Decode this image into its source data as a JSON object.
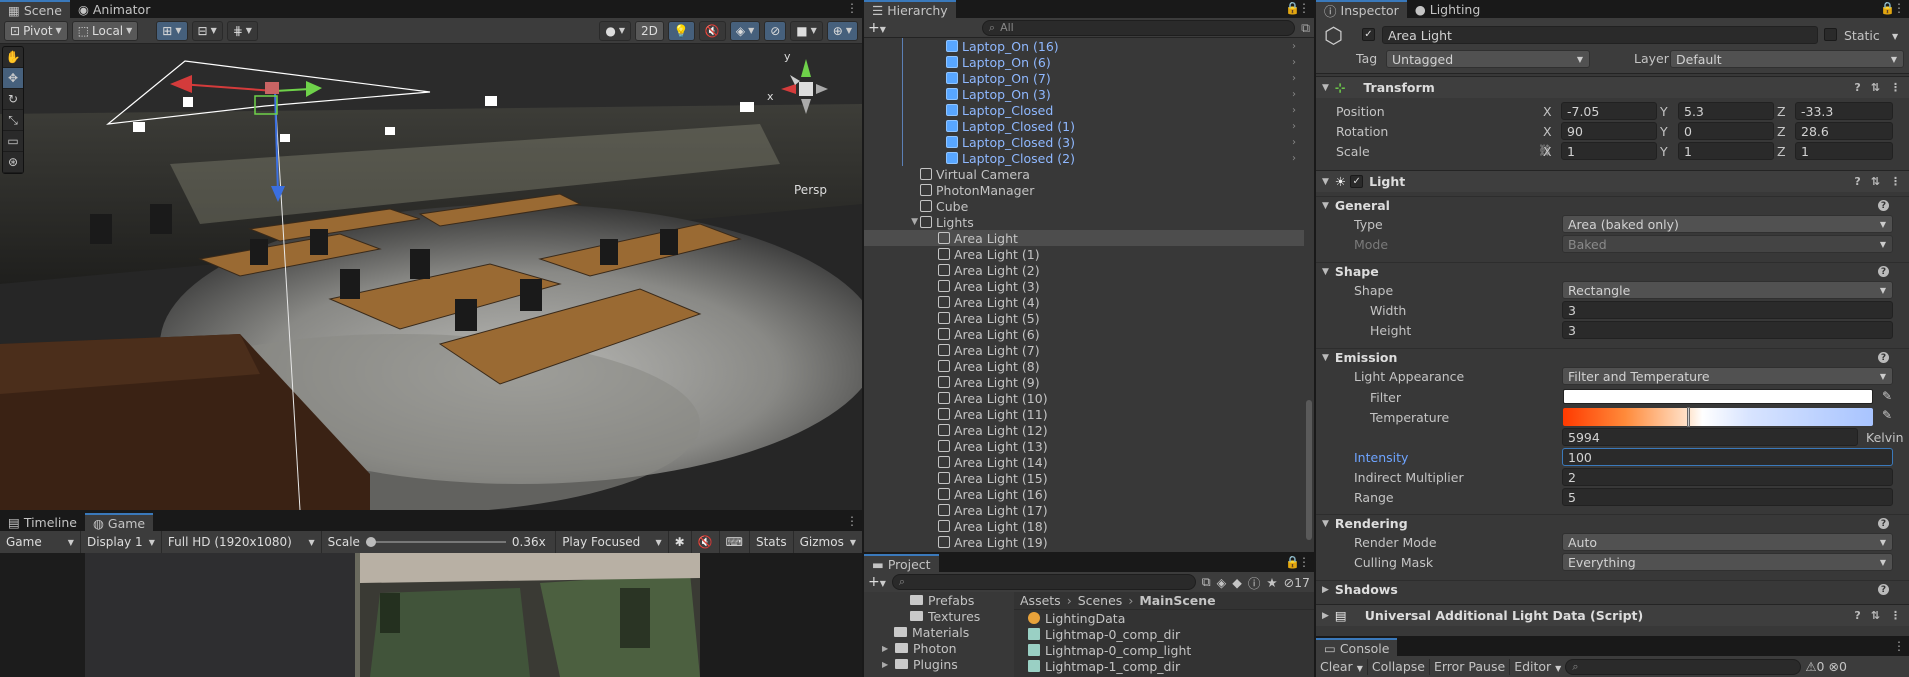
{
  "scene": {
    "tabs": [
      {
        "label": "Scene",
        "active": true
      },
      {
        "label": "Animator",
        "active": false
      }
    ],
    "toolbar": {
      "pivot": "Pivot",
      "local": "Local",
      "mode_2d": "2D"
    },
    "persp_label": "Persp",
    "gizmo_axes": {
      "x": "x",
      "y": "y"
    }
  },
  "game": {
    "tabs": [
      {
        "label": "Timeline",
        "active": false
      },
      {
        "label": "Game",
        "active": true
      }
    ],
    "toolbar": {
      "view": "Game",
      "display": "Display 1",
      "resolution": "Full HD (1920x1080)",
      "scale_label": "Scale",
      "scale_value": "0.36x",
      "play_mode": "Play Focused",
      "stats": "Stats",
      "gizmos": "Gizmos"
    }
  },
  "hierarchy": {
    "tab": "Hierarchy",
    "search_placeholder": "All",
    "items": [
      {
        "label": "Laptop_On (16)",
        "depth": 2,
        "prefab": true,
        "arrow": true
      },
      {
        "label": "Laptop_On (6)",
        "depth": 2,
        "prefab": true,
        "arrow": true
      },
      {
        "label": "Laptop_On (7)",
        "depth": 2,
        "prefab": true,
        "arrow": true
      },
      {
        "label": "Laptop_On (3)",
        "depth": 2,
        "prefab": true,
        "arrow": true
      },
      {
        "label": "Laptop_Closed",
        "depth": 2,
        "prefab": true,
        "arrow": true
      },
      {
        "label": "Laptop_Closed (1)",
        "depth": 2,
        "prefab": true,
        "arrow": true
      },
      {
        "label": "Laptop_Closed (3)",
        "depth": 2,
        "prefab": true,
        "arrow": true
      },
      {
        "label": "Laptop_Closed (2)",
        "depth": 2,
        "prefab": true,
        "arrow": true
      },
      {
        "label": "Virtual Camera",
        "depth": 1,
        "prefab": false
      },
      {
        "label": "PhotonManager",
        "depth": 1,
        "prefab": false
      },
      {
        "label": "Cube",
        "depth": 1,
        "prefab": false
      },
      {
        "label": "Lights",
        "depth": 1,
        "prefab": false,
        "expanded": true
      },
      {
        "label": "Area Light",
        "depth": 2,
        "prefab": false,
        "selected": true
      },
      {
        "label": "Area Light (1)",
        "depth": 2,
        "prefab": false
      },
      {
        "label": "Area Light (2)",
        "depth": 2,
        "prefab": false
      },
      {
        "label": "Area Light (3)",
        "depth": 2,
        "prefab": false
      },
      {
        "label": "Area Light (4)",
        "depth": 2,
        "prefab": false
      },
      {
        "label": "Area Light (5)",
        "depth": 2,
        "prefab": false
      },
      {
        "label": "Area Light (6)",
        "depth": 2,
        "prefab": false
      },
      {
        "label": "Area Light (7)",
        "depth": 2,
        "prefab": false
      },
      {
        "label": "Area Light (8)",
        "depth": 2,
        "prefab": false
      },
      {
        "label": "Area Light (9)",
        "depth": 2,
        "prefab": false
      },
      {
        "label": "Area Light (10)",
        "depth": 2,
        "prefab": false
      },
      {
        "label": "Area Light (11)",
        "depth": 2,
        "prefab": false
      },
      {
        "label": "Area Light (12)",
        "depth": 2,
        "prefab": false
      },
      {
        "label": "Area Light (13)",
        "depth": 2,
        "prefab": false
      },
      {
        "label": "Area Light (14)",
        "depth": 2,
        "prefab": false
      },
      {
        "label": "Area Light (15)",
        "depth": 2,
        "prefab": false
      },
      {
        "label": "Area Light (16)",
        "depth": 2,
        "prefab": false
      },
      {
        "label": "Area Light (17)",
        "depth": 2,
        "prefab": false
      },
      {
        "label": "Area Light (18)",
        "depth": 2,
        "prefab": false
      },
      {
        "label": "Area Light (19)",
        "depth": 2,
        "prefab": false
      }
    ]
  },
  "project": {
    "tab": "Project",
    "hidden_count": "17",
    "tree": [
      {
        "label": "Prefabs",
        "depth": 2
      },
      {
        "label": "Textures",
        "depth": 2
      },
      {
        "label": "Materials",
        "depth": 1
      },
      {
        "label": "Photon",
        "depth": 1,
        "collapsed": true
      },
      {
        "label": "Plugins",
        "depth": 1,
        "collapsed": true
      }
    ],
    "breadcrumb": [
      "Assets",
      "Scenes",
      "MainScene"
    ],
    "assets": [
      {
        "label": "LightingData",
        "icon": "lighting-data-icon"
      },
      {
        "label": "Lightmap-0_comp_dir",
        "icon": "texture-icon"
      },
      {
        "label": "Lightmap-0_comp_light",
        "icon": "texture-icon"
      },
      {
        "label": "Lightmap-1_comp_dir",
        "icon": "texture-icon"
      }
    ]
  },
  "inspector": {
    "tabs": [
      {
        "label": "Inspector",
        "active": true
      },
      {
        "label": "Lighting",
        "active": false
      }
    ],
    "object_name": "Area Light",
    "static_label": "Static",
    "tag_label": "Tag",
    "tag_value": "Untagged",
    "layer_label": "Layer",
    "layer_value": "Default",
    "transform": {
      "title": "Transform",
      "position_label": "Position",
      "rotation_label": "Rotation",
      "scale_label": "Scale",
      "position": {
        "x": "-7.05",
        "y": "5.3",
        "z": "-33.3"
      },
      "rotation": {
        "x": "90",
        "y": "0",
        "z": "28.6"
      },
      "scale": {
        "x": "1",
        "y": "1",
        "z": "1"
      }
    },
    "light": {
      "title": "Light",
      "general_title": "General",
      "type_label": "Type",
      "type_value": "Area (baked only)",
      "mode_label": "Mode",
      "mode_value": "Baked",
      "shape_title": "Shape",
      "shape_label": "Shape",
      "shape_value": "Rectangle",
      "width_label": "Width",
      "width_value": "3",
      "height_label": "Height",
      "height_value": "3",
      "emission_title": "Emission",
      "appearance_label": "Light Appearance",
      "appearance_value": "Filter and Temperature",
      "filter_label": "Filter",
      "filter_color": "#ffffff",
      "temperature_label": "Temperature",
      "temperature_value": "5994",
      "kelvin_label": "Kelvin",
      "intensity_label": "Intensity",
      "intensity_value": "100",
      "indirect_label": "Indirect Multiplier",
      "indirect_value": "2",
      "range_label": "Range",
      "range_value": "5",
      "rendering_title": "Rendering",
      "render_mode_label": "Render Mode",
      "render_mode_value": "Auto",
      "culling_label": "Culling Mask",
      "culling_value": "Everything",
      "shadows_title": "Shadows"
    },
    "additional": {
      "title": "Universal Additional Light Data (Script)"
    }
  },
  "console": {
    "tab": "Console",
    "clear": "Clear",
    "collapse": "Collapse",
    "error_pause": "Error Pause",
    "editor": "Editor",
    "warn_count": "0",
    "error_count": "0"
  },
  "colors": {
    "accent": "#3a79bb",
    "prefab_text": "#8fb8ff",
    "intensity_label": "#6ea4ff",
    "x_axis": "#d43b3b",
    "y_axis": "#6fd24a",
    "z_axis": "#3b6fe0"
  }
}
